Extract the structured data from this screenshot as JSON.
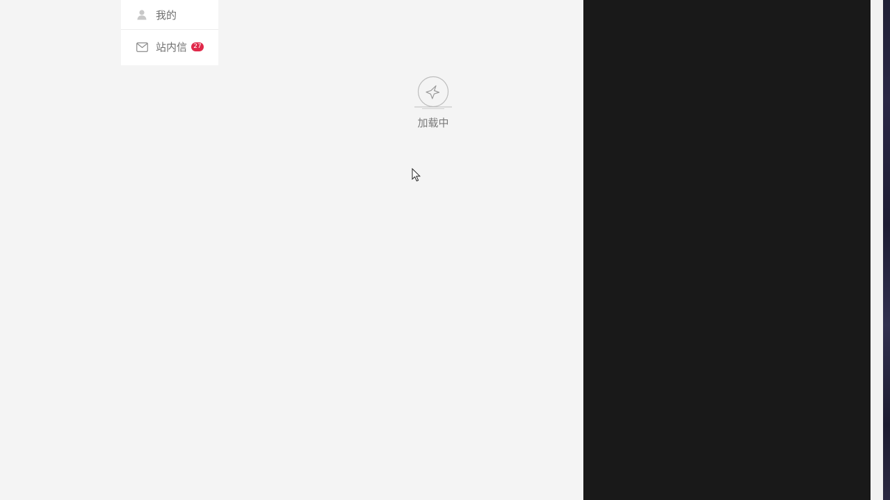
{
  "menu": {
    "items": [
      {
        "label": "我的",
        "icon": "user-icon"
      },
      {
        "label": "站内信",
        "icon": "mail-icon",
        "badge": "27"
      }
    ]
  },
  "loading": {
    "text": "加载中",
    "icon": "sparkle-icon"
  },
  "colors": {
    "background": "#f4f4f4",
    "menu_background": "#ffffff",
    "badge": "#e0294a",
    "dark_panel": "#191919"
  }
}
